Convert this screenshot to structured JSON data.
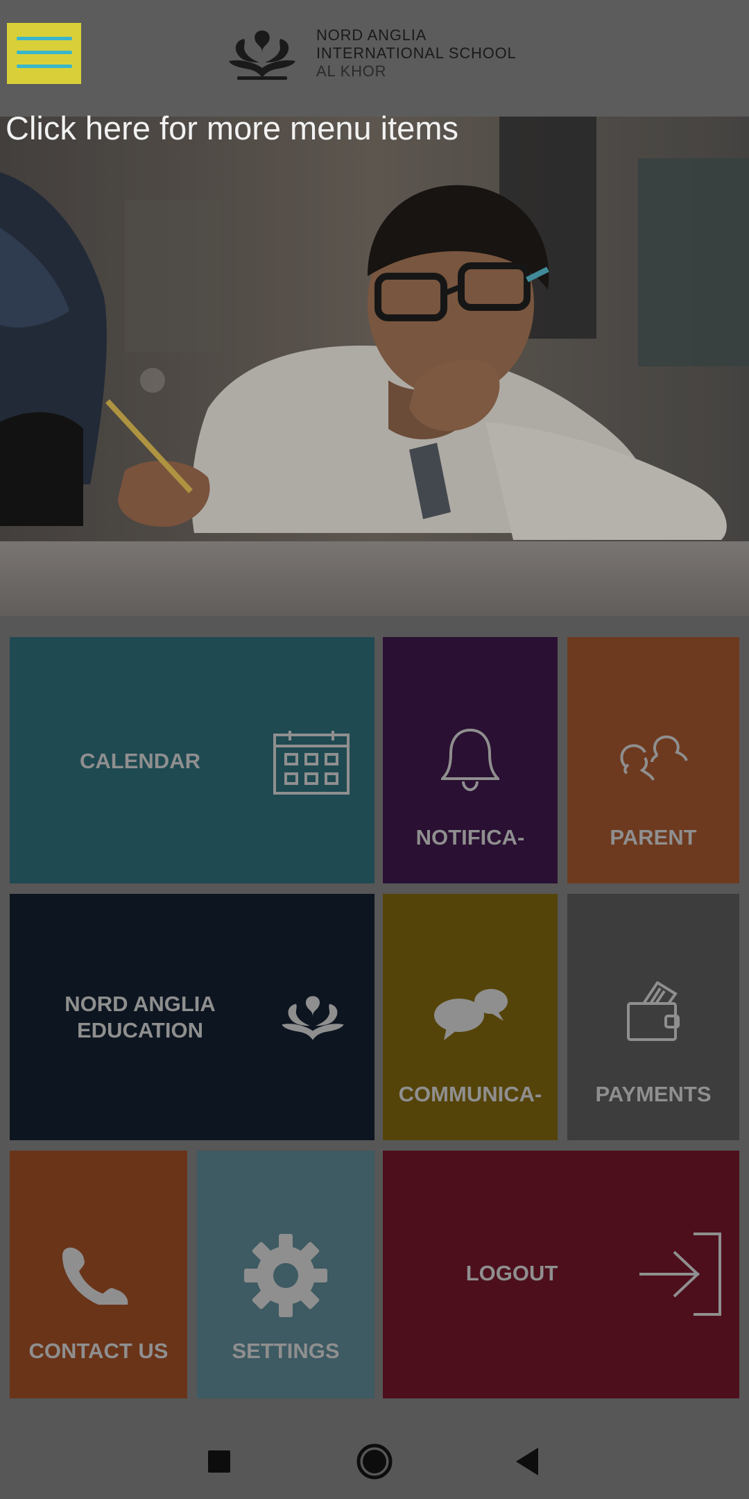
{
  "header": {
    "menu_button": "menu-icon",
    "logo_line1": "NORD ANGLIA",
    "logo_line2": "INTERNATIONAL SCHOOL",
    "logo_line3": "AL KHOR"
  },
  "hero": {
    "hint_text": "Click here for more menu items"
  },
  "tiles": {
    "calendar": {
      "label": "CALENDAR",
      "icon": "calendar-icon",
      "color": "#1f4a52"
    },
    "notifications": {
      "label": "NOTIFICA-",
      "icon": "bell-icon",
      "color": "#2a1033"
    },
    "parent": {
      "label": "PARENT",
      "icon": "parent-icon",
      "color": "#6e3a1f"
    },
    "nord_anglia": {
      "label_line1": "NORD ANGLIA",
      "label_line2": "EDUCATION",
      "icon": "crest-icon",
      "color": "#0d1520"
    },
    "communications": {
      "label": "COMMUNICA-",
      "icon": "chat-icon",
      "color": "#55440a"
    },
    "payments": {
      "label": "PAYMENTS",
      "icon": "wallet-icon",
      "color": "#3d3d3d"
    },
    "contact": {
      "label": "CONTACT US",
      "icon": "phone-icon",
      "color": "#6a3419"
    },
    "settings": {
      "label": "SETTINGS",
      "icon": "gear-icon",
      "color": "#3e5a62"
    },
    "logout": {
      "label": "LOGOUT",
      "icon": "logout-icon",
      "color": "#4d0f1c"
    }
  },
  "navbar": {
    "recent": "square-icon",
    "home": "circle-icon",
    "back": "triangle-back-icon"
  }
}
